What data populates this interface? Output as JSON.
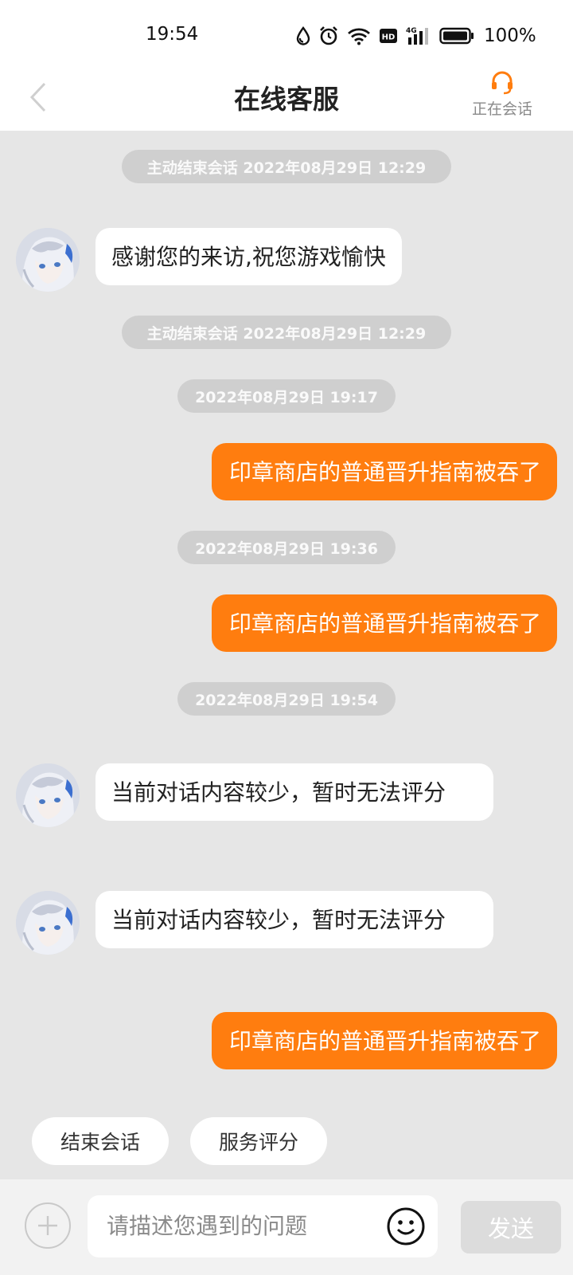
{
  "status_bar": {
    "time": "19:54",
    "battery_percent": "100%",
    "icons": [
      "water-drop-icon",
      "alarm-icon",
      "wifi-icon",
      "hd-icon",
      "signal-4g-icon",
      "battery-icon"
    ],
    "hd_label": "HD",
    "network_label": "4G"
  },
  "header": {
    "back_icon": "chevron-left-icon",
    "title": "在线客服",
    "session_icon": "headset-icon",
    "session_label": "正在会话",
    "accent_color": "#ff7d0f"
  },
  "messages": [
    {
      "type": "system",
      "text": "主动结束会话 2022年08月29日 12:29"
    },
    {
      "type": "incoming",
      "text": "感谢您的来访,祝您游戏愉快"
    },
    {
      "type": "system",
      "text": "主动结束会话 2022年08月29日 12:29"
    },
    {
      "type": "timestamp",
      "text": "2022年08月29日 19:17"
    },
    {
      "type": "outgoing",
      "text": "印章商店的普通晋升指南被吞了"
    },
    {
      "type": "timestamp",
      "text": "2022年08月29日 19:36"
    },
    {
      "type": "outgoing",
      "text": "印章商店的普通晋升指南被吞了"
    },
    {
      "type": "timestamp",
      "text": "2022年08月29日 19:54"
    },
    {
      "type": "incoming",
      "text": "当前对话内容较少，暂时无法评分"
    },
    {
      "type": "incoming",
      "text": "当前对话内容较少，暂时无法评分"
    },
    {
      "type": "outgoing",
      "text": "印章商店的普通晋升指南被吞了"
    }
  ],
  "quick_actions": {
    "end_session": "结束会话",
    "rate_service": "服务评分"
  },
  "input_bar": {
    "plus_icon": "plus-icon",
    "placeholder": "请描述您遇到的问题",
    "value": "",
    "emoji_icon": "smiley-icon",
    "send_label": "发送"
  },
  "colors": {
    "outgoing_bubble": "#ff7d0f",
    "incoming_bubble": "#ffffff",
    "chat_background": "#e6e6e6",
    "system_pill": "#cfcfcf",
    "send_button_disabled": "#dcdcdc"
  }
}
